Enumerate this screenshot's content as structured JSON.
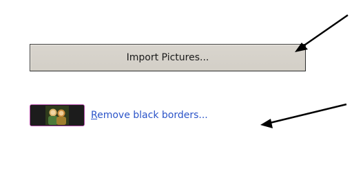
{
  "import_button": {
    "label": "Import Pictures..."
  },
  "remove_borders_link": {
    "accel_letter": "R",
    "rest_label": "emove black borders..."
  },
  "thumbnail": {
    "icon": "photo-thumbnail-icon",
    "border_color": "#b24aa6"
  },
  "annotations": {
    "arrow_color": "#000000"
  }
}
